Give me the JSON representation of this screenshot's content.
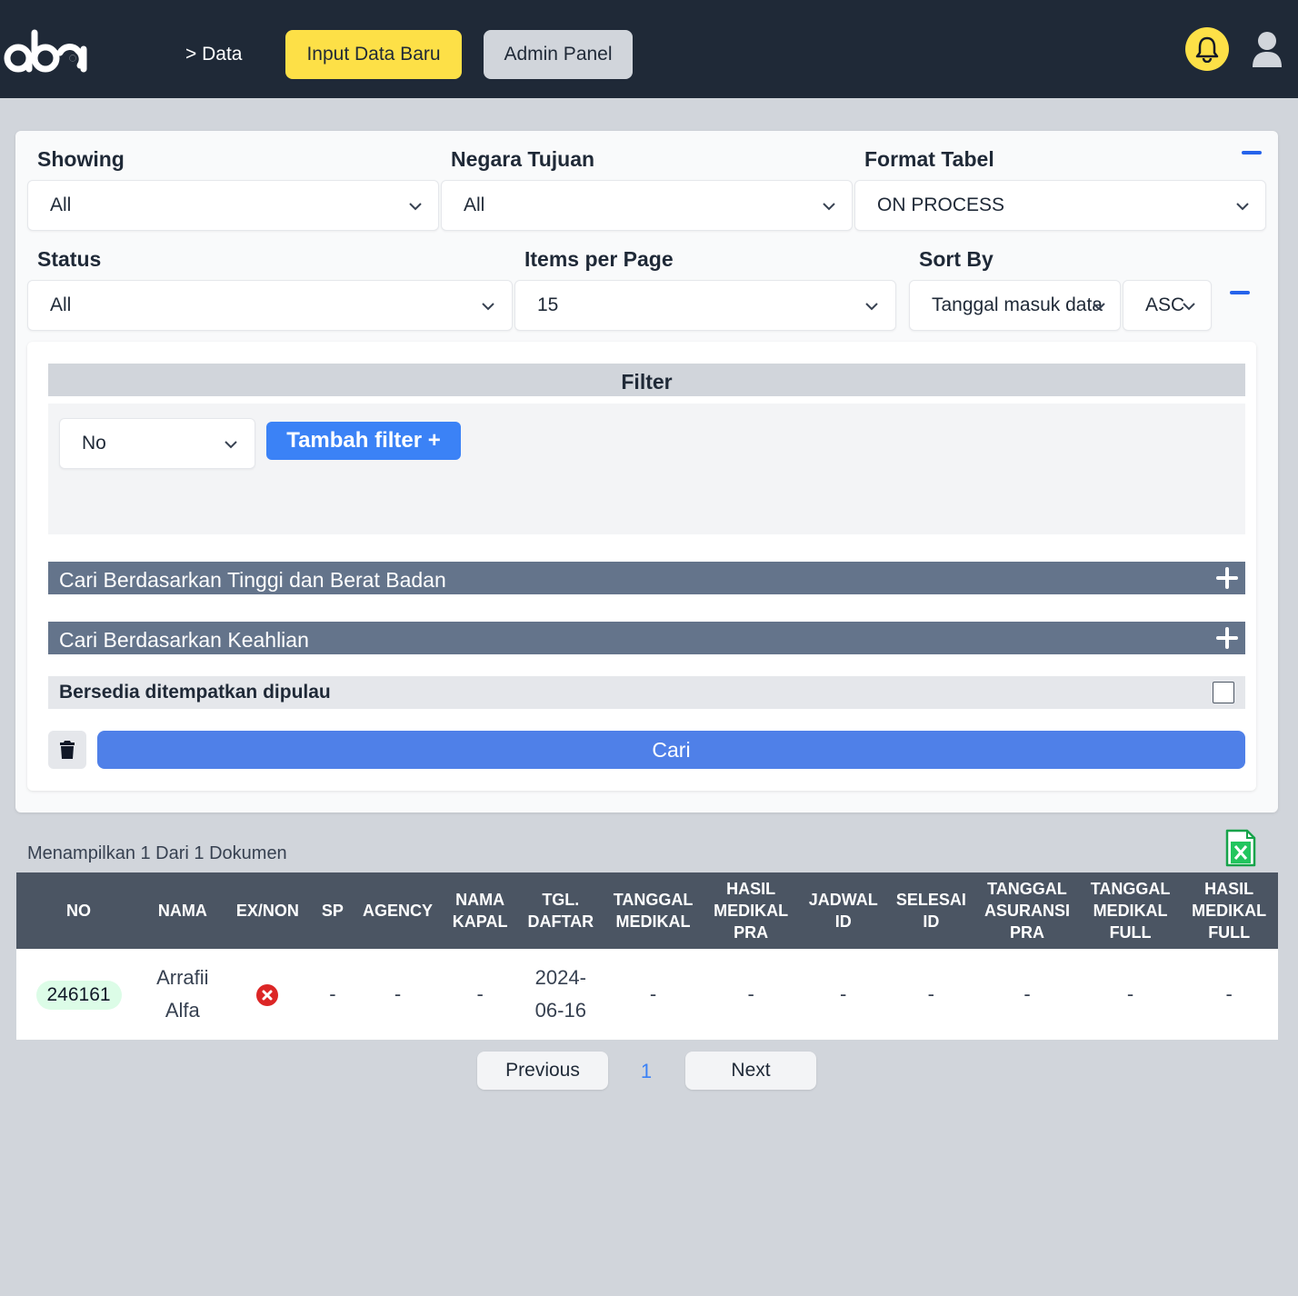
{
  "header": {
    "logo_text": "aba",
    "breadcrumb": "> Data",
    "input_button": "Input Data Baru",
    "admin_button": "Admin Panel",
    "bell_icon": "bell-icon",
    "user_icon": "user-icon"
  },
  "filters": {
    "showing": {
      "label": "Showing",
      "value": "All"
    },
    "negara": {
      "label": "Negara Tujuan",
      "value": "All"
    },
    "format": {
      "label": "Format Tabel",
      "value": "ON PROCESS"
    },
    "status": {
      "label": "Status",
      "value": "All"
    },
    "items": {
      "label": "Items per Page",
      "value": "15"
    },
    "sort": {
      "label": "Sort By",
      "value": "Tanggal masuk data",
      "order": "ASC"
    }
  },
  "filter_panel": {
    "title": "Filter",
    "select_value": "No",
    "add_button": "Tambah filter +",
    "accordion_1": "Cari Berdasarkan Tinggi dan Berat Badan",
    "accordion_2": "Cari Berdasarkan Keahlian",
    "island_label": "Bersedia ditempatkan dipulau",
    "search_button": "Cari"
  },
  "results": {
    "count_text": "Menampilkan 1 Dari 1 Dokumen",
    "columns": [
      "NO",
      "NAMA",
      "EX/NON",
      "SP",
      "AGENCY",
      "NAMA KAPAL",
      "TGL. DAFTAR",
      "TANGGAL MEDIKAL",
      "HASIL MEDIKAL PRA",
      "JADWAL ID",
      "SELESAI ID",
      "TANGGAL ASURANSI PRA",
      "TANGGAL MEDIKAL FULL",
      "HASIL MEDIKAL FULL"
    ],
    "rows": [
      {
        "no": "246161",
        "nama": "Arrafii Alfa",
        "sp": "-",
        "agency": "-",
        "kapal": "-",
        "tgl_daftar": "2024-06-16",
        "tgl_medikal": "-",
        "hasil_pra": "-",
        "jadwal_id": "-",
        "selesai_id": "-",
        "asuransi_pra": "-",
        "medikal_full": "-",
        "hasil_full": "-"
      }
    ]
  },
  "pagination": {
    "previous": "Previous",
    "page": "1",
    "next": "Next"
  },
  "colors": {
    "topbar": "#1f2937",
    "accent_yellow": "#fde047",
    "primary_blue": "#3b82f6",
    "excel_green": "#16a34a",
    "error_red": "#dc2626"
  }
}
